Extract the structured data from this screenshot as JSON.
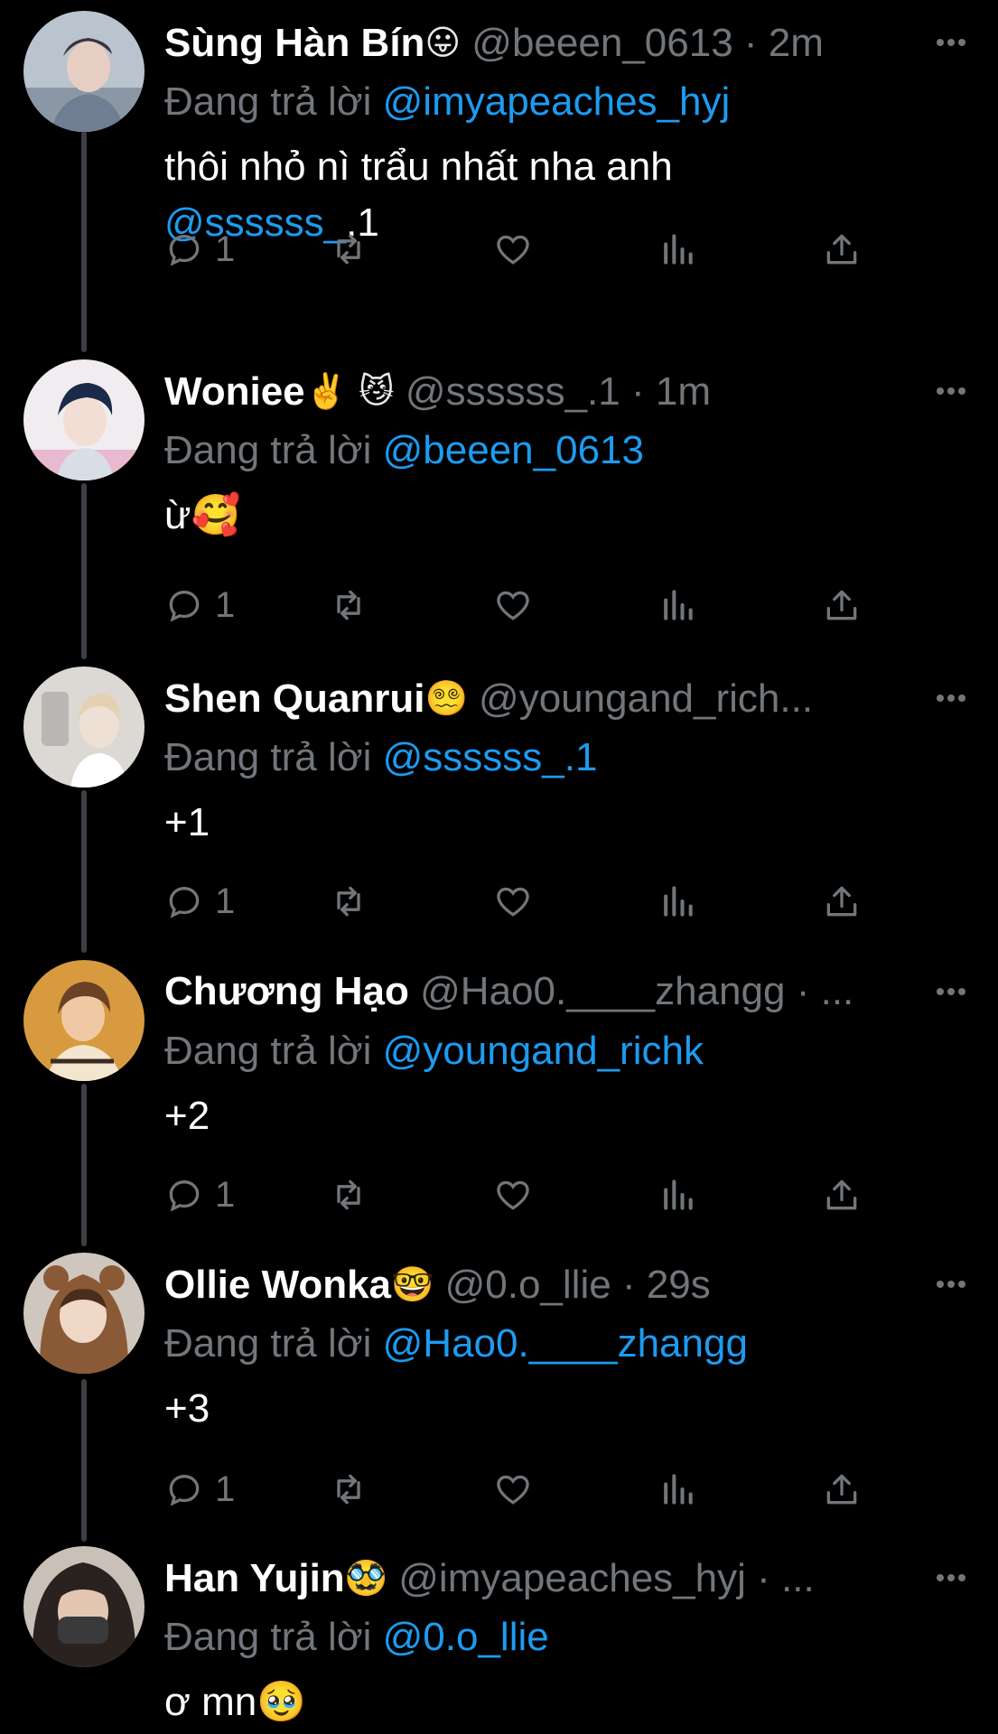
{
  "colors": {
    "background": "#000000",
    "text": "#ffffff",
    "muted": "#71767b",
    "link": "#1d9bf0",
    "thread_line": "#3b3f43"
  },
  "reply_prefix": "Đang trả lời",
  "tweets": [
    {
      "name": "Sùng Hàn Bín",
      "emoji": "😛",
      "handle": "@beeen_0613",
      "dot": "·",
      "time": "2m",
      "reply_to": "@imyapeaches_hyj",
      "text": "thôi nhỏ nì trẩu nhất nha anh\n",
      "text_mention": "@ssssss_",
      "text_after": ".1",
      "reply_count": "1"
    },
    {
      "name": "Woniee",
      "emoji": "✌️ 😼",
      "handle": "@ssssss_.1",
      "dot": "·",
      "time": "1m",
      "reply_to": "@beeen_0613",
      "text": "ừ🥰",
      "reply_count": "1"
    },
    {
      "name": "Shen Quanrui",
      "emoji": "😵‍💫",
      "handle": "@youngand_rich...",
      "dot": "",
      "time": "",
      "reply_to": "@ssssss_.1",
      "text": "+1",
      "reply_count": "1"
    },
    {
      "name": "Chương Hạo",
      "emoji": "",
      "handle": "@Hao0.____zhangg",
      "dot": "·",
      "time": "...",
      "reply_to": "@youngand_richk",
      "text": "+2",
      "reply_count": "1"
    },
    {
      "name": "Ollie Wonka",
      "emoji": "🤓",
      "handle": "@0.o_llie",
      "dot": "·",
      "time": "29s",
      "reply_to": "@Hao0.____zhangg",
      "text": "+3",
      "reply_count": "1"
    },
    {
      "name": "Han Yujin",
      "emoji": "🥸",
      "handle": "@imyapeaches_hyj",
      "dot": "·",
      "time": "...",
      "reply_to": "@0.o_llie",
      "text": "ơ mn🥹",
      "reply_count": ""
    }
  ]
}
